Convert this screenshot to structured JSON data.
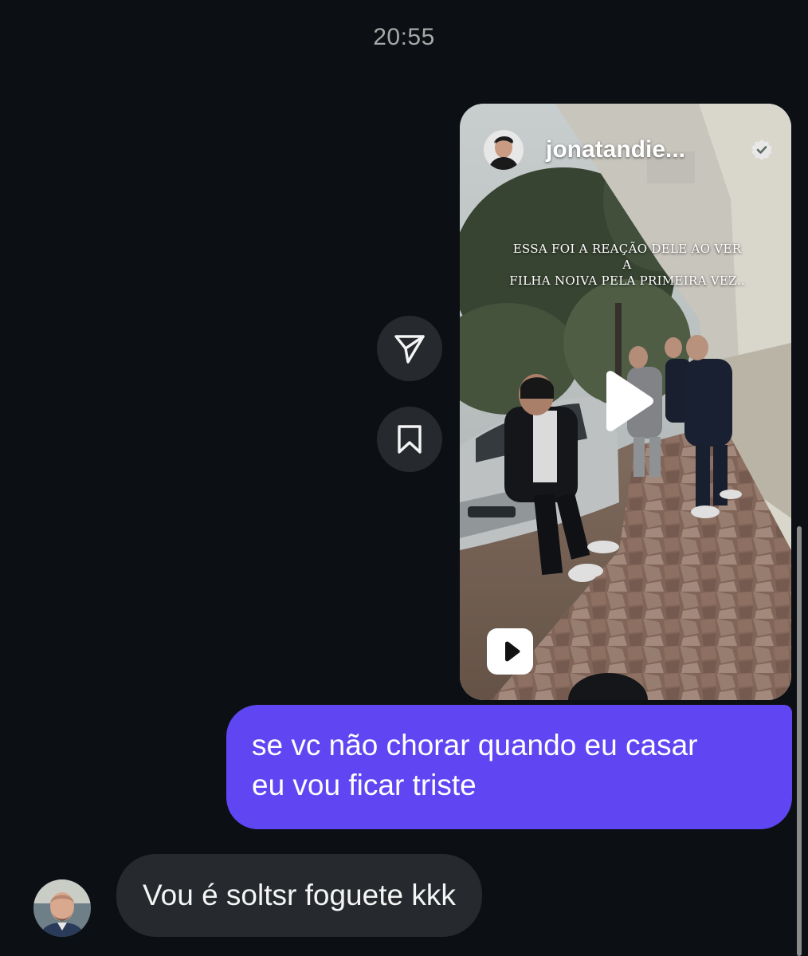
{
  "thread": {
    "timestamp": "20:55"
  },
  "reel": {
    "username": "jonatandie...",
    "verified": true,
    "caption_line1": "ESSA FOI A REAÇÃO DELE AO VER A",
    "caption_line2": "FILHA NOIVA PELA PRIMEIRA VEZ..",
    "play_icon": "play-icon",
    "badge_icon": "reels-icon"
  },
  "actions": {
    "share_icon": "send-icon",
    "save_icon": "bookmark-icon"
  },
  "messages": {
    "outgoing": {
      "line1": "se vc não chorar quando eu casar",
      "line2": "eu vou ficar triste"
    },
    "incoming": {
      "text": "Vou é soltsr foguete kkk"
    }
  },
  "colors": {
    "background": "#0c1014",
    "outgoing_bubble": "#6046f2",
    "incoming_bubble": "#262a2f",
    "timestamp": "#a8a8a8"
  }
}
